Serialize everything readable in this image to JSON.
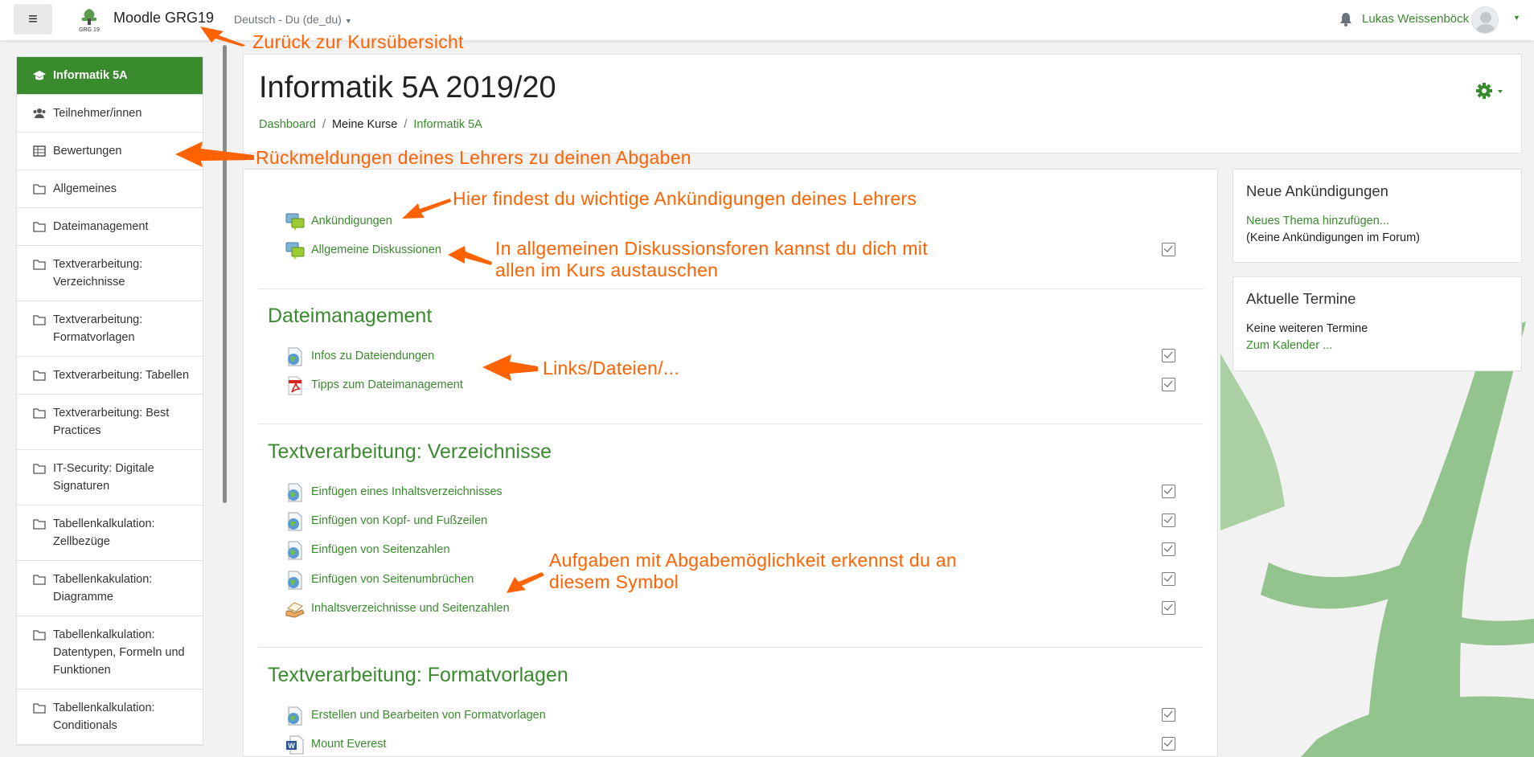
{
  "navbar": {
    "site_name": "Moodle GRG19",
    "language": "Deutsch ‎- Du ‎(de_du)‎",
    "user_name": "Lukas Weissenböck"
  },
  "drawer": {
    "items": [
      {
        "label": "Informatik 5A",
        "icon": "graduation-cap-icon"
      },
      {
        "label": "Teilnehmer/innen",
        "icon": "users-icon"
      },
      {
        "label": "Bewertungen",
        "icon": "table-icon"
      },
      {
        "label": "Allgemeines",
        "icon": "folder-icon"
      },
      {
        "label": "Dateimanagement",
        "icon": "folder-icon"
      },
      {
        "label": "Textverarbeitung: Verzeichnisse",
        "icon": "folder-icon"
      },
      {
        "label": "Textverarbeitung: Formatvorlagen",
        "icon": "folder-icon"
      },
      {
        "label": "Textverarbeitung: Tabellen",
        "icon": "folder-icon"
      },
      {
        "label": "Textverarbeitung: Best Practices",
        "icon": "folder-icon"
      },
      {
        "label": "IT-Security: Digitale Signaturen",
        "icon": "folder-icon"
      },
      {
        "label": "Tabellenkalkulation: Zellbezüge",
        "icon": "folder-icon"
      },
      {
        "label": "Tabellenkakulation: Diagramme",
        "icon": "folder-icon"
      },
      {
        "label": "Tabellenkalkulation: Datentypen, Formeln und Funktionen",
        "icon": "folder-icon"
      },
      {
        "label": "Tabellenkalkulation: Conditionals",
        "icon": "folder-icon"
      }
    ]
  },
  "header": {
    "title": "Informatik 5A 2019/20",
    "breadcrumb": [
      "Dashboard",
      "Meine Kurse",
      "Informatik 5A"
    ]
  },
  "sections": [
    {
      "title": "",
      "activities": [
        {
          "label": "Ankündigungen",
          "icon": "forum-icon",
          "check": false
        },
        {
          "label": "Allgemeine Diskussionen",
          "icon": "forum-icon",
          "check": true
        }
      ]
    },
    {
      "title": "Dateimanagement",
      "activities": [
        {
          "label": "Infos zu Dateiendungen",
          "icon": "url-icon",
          "check": true
        },
        {
          "label": "Tipps zum Dateimanagement",
          "icon": "pdf-icon",
          "check": true
        }
      ]
    },
    {
      "title": "Textverarbeitung: Verzeichnisse",
      "activities": [
        {
          "label": "Einfügen eines Inhaltsverzeichnisses",
          "icon": "url-icon",
          "check": true
        },
        {
          "label": "Einfügen von Kopf- und Fußzeilen",
          "icon": "url-icon",
          "check": true
        },
        {
          "label": "Einfügen von Seitenzahlen",
          "icon": "url-icon",
          "check": true
        },
        {
          "label": "Einfügen von Seitenumbrüchen",
          "icon": "url-icon",
          "check": true
        },
        {
          "label": "Inhaltsverzeichnisse und Seitenzahlen",
          "icon": "assignment-icon",
          "check": true
        }
      ]
    },
    {
      "title": "Textverarbeitung: Formatvorlagen",
      "activities": [
        {
          "label": "Erstellen und Bearbeiten von Formatvorlagen",
          "icon": "url-icon",
          "check": true
        },
        {
          "label": "Mount Everest",
          "icon": "word-doc-icon",
          "check": true
        }
      ]
    }
  ],
  "blocks": {
    "news": {
      "title": "Neue Ankündigungen",
      "link": "Neues Thema hinzufügen...",
      "text": "(Keine Ankündigungen im Forum)"
    },
    "events": {
      "title": "Aktuelle Termine",
      "text": "Keine weiteren Termine",
      "link": "Zum Kalender ..."
    }
  },
  "annotations": {
    "course_overview": "Zurück zur Kursübersicht",
    "grades": "Rückmeldungen deines Lehrers zu deinen Abgaben",
    "announcements": "Hier findest du wichtige Ankündigungen deines Lehrers",
    "forums_line1": "In allgemeinen Diskussionsforen kannst du dich mit",
    "forums_line2": "allen im Kurs austauschen",
    "links": "Links/Dateien/...",
    "assign_line1": "Aufgaben mit Abgabemöglichkeit erkennst du an",
    "assign_line2": "diesem Symbol"
  },
  "colors": {
    "brand": "#3a8a2e",
    "annotation": "#ff6200",
    "tree": "#8fbf8a"
  }
}
